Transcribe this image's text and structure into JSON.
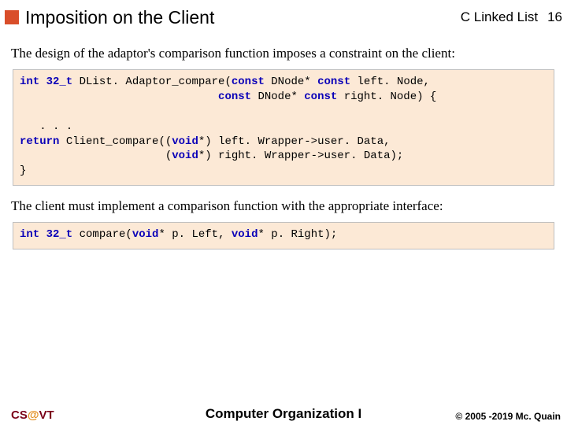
{
  "header": {
    "title": "Imposition on the Client",
    "topic": "C Linked List",
    "page": "16"
  },
  "body": {
    "intro": "The design of the adaptor's comparison function imposes a constraint on the client:",
    "code1": {
      "ret_type": "int 32_t",
      "sig1_a": " DList. Adaptor_compare(",
      "kw_const": "const",
      "node_ptr": " DNode* ",
      "sig1_b": " left. Node,",
      "pad1": "                              ",
      "sig2_b": " right. Node) {",
      "ellipsis": "   . . .",
      "kw_return": "return",
      "ret_a": " Client_compare((",
      "kw_void": "void",
      "ret_b": "*) left. Wrapper->user. Data,",
      "pad2": "                      (",
      "ret_c": "*) right. Wrapper->user. Data);",
      "close": "}"
    },
    "mid": "The client must implement a comparison function with the appropriate interface:",
    "code2": {
      "ret_type": "int 32_t",
      "compare": " compare(",
      "kw_void": "void",
      "a1": "* p. Left, ",
      "a2": "* p. Right);"
    }
  },
  "footer": {
    "brand_cs": "CS",
    "brand_at": "@",
    "brand_vt": "VT",
    "course": "Computer Organization I",
    "copyright": "© 2005 -2019 Mc. Quain"
  }
}
